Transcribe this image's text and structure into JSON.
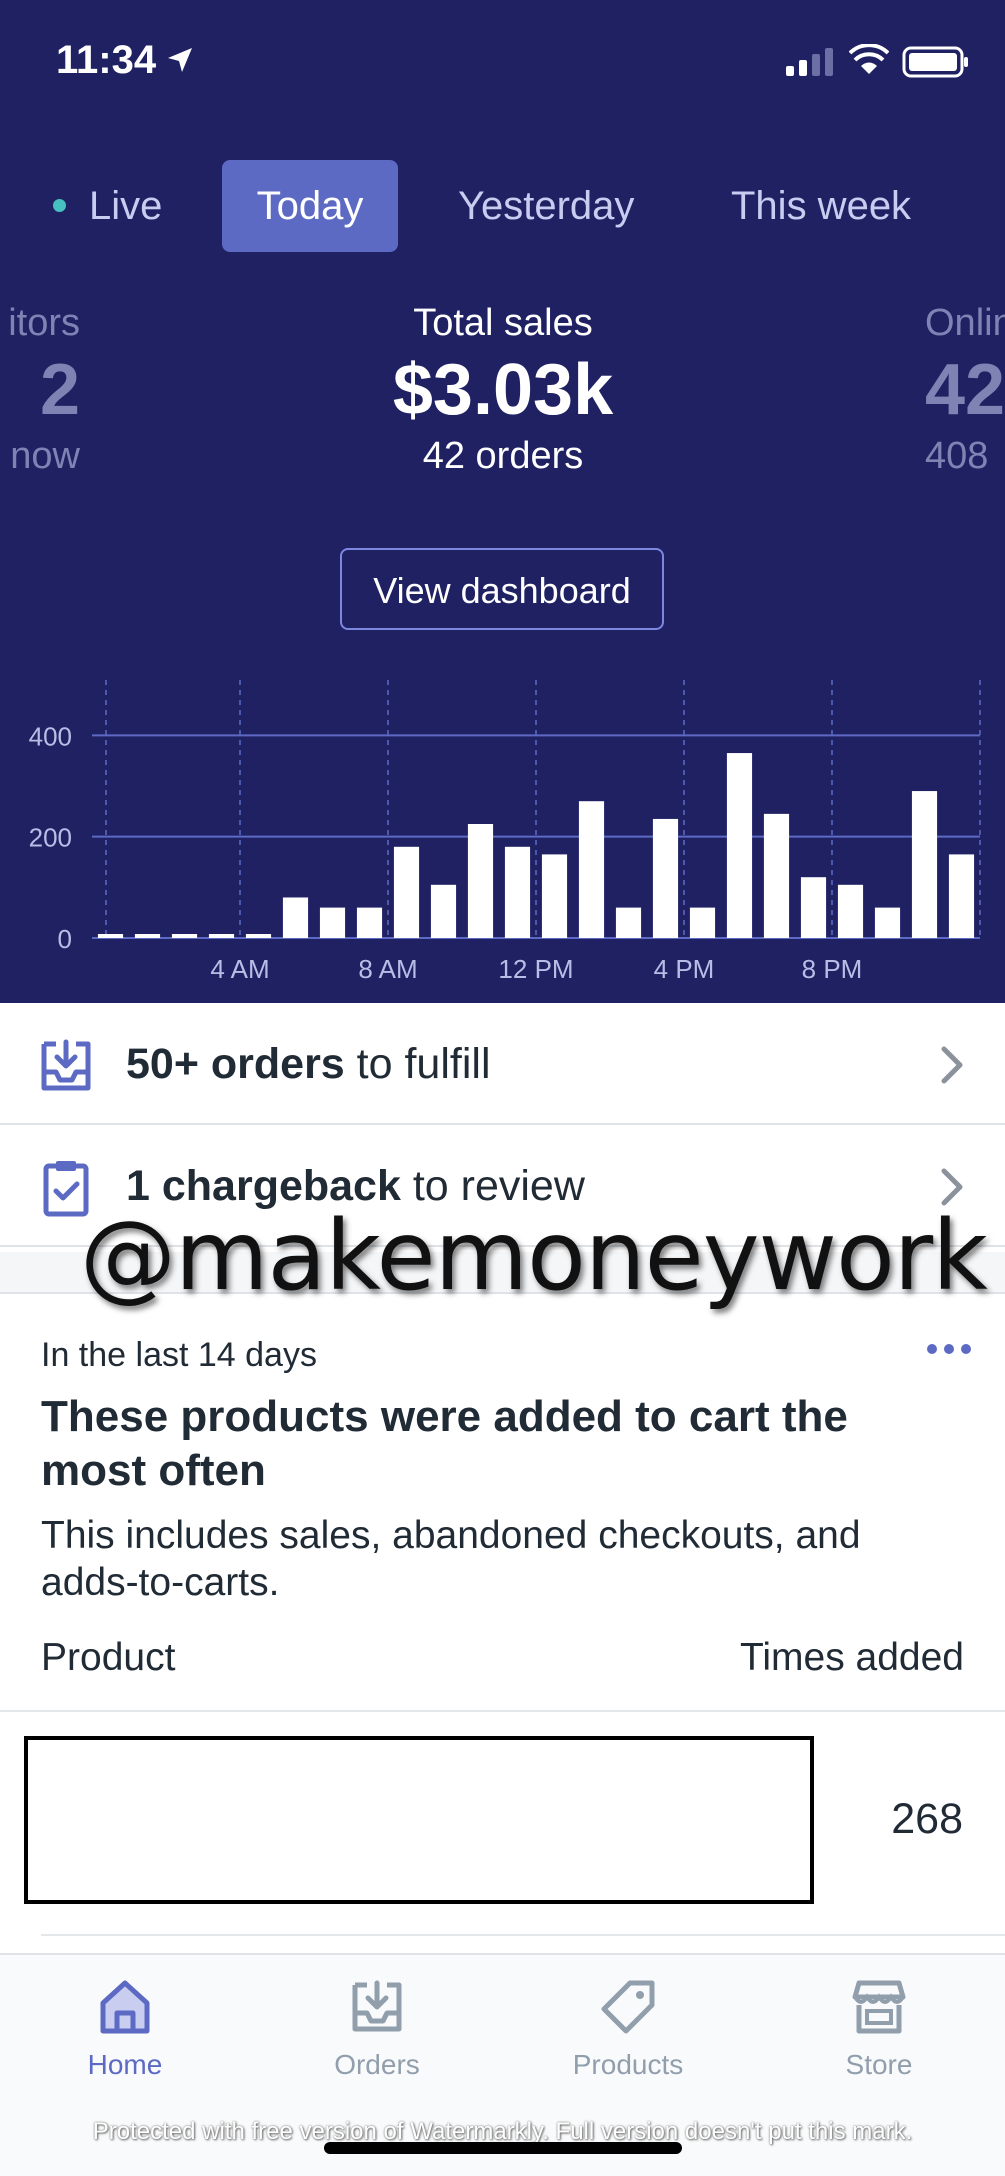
{
  "status_bar": {
    "time": "11:34"
  },
  "tabs": [
    {
      "label": "Live"
    },
    {
      "label": "Today"
    },
    {
      "label": "Yesterday"
    },
    {
      "label": "This week"
    }
  ],
  "active_tab": "Today",
  "metrics": {
    "left_partial": {
      "label": "itors",
      "value": "2",
      "sub": "now"
    },
    "main": {
      "label": "Total sales",
      "value": "$3.03k",
      "sub": "42 orders"
    },
    "right_partial": {
      "label": "Onlin",
      "value": "42",
      "sub": "408"
    }
  },
  "view_dashboard_label": "View dashboard",
  "chart_data": {
    "type": "bar",
    "categories": [
      "12 AM",
      "1 AM",
      "2 AM",
      "3 AM",
      "4 AM",
      "5 AM",
      "6 AM",
      "7 AM",
      "8 AM",
      "9 AM",
      "10 AM",
      "11 AM",
      "12 PM",
      "1 PM",
      "2 PM",
      "3 PM",
      "4 PM",
      "5 PM",
      "6 PM",
      "7 PM",
      "8 PM",
      "9 PM",
      "10 PM",
      "11 PM"
    ],
    "values": [
      5,
      5,
      5,
      5,
      5,
      80,
      60,
      60,
      180,
      105,
      225,
      180,
      165,
      270,
      60,
      235,
      60,
      365,
      245,
      120,
      105,
      60,
      290,
      165
    ],
    "ylim": [
      0,
      450
    ],
    "yticks": [
      "0",
      "200",
      "400"
    ],
    "xtick_labels": [
      "4 AM",
      "8 AM",
      "12 PM",
      "4 PM",
      "8 PM"
    ],
    "grid": true,
    "colors": {
      "bars": "#ffffff",
      "grid": "#5c6ac4",
      "background": "#1f2163"
    }
  },
  "tasks": {
    "orders": {
      "bold": "50+ orders",
      "rest": " to fulfill"
    },
    "chargeback": {
      "bold": "1 chargeback",
      "rest": " to review"
    }
  },
  "watermark_text": "@makemoneywork",
  "card": {
    "subtitle": "In the last 14 days",
    "title": "These products were added to cart the most often",
    "description": "This includes sales, abandoned checkouts, and adds-to-carts.",
    "col_product": "Product",
    "col_times": "Times added",
    "rows": [
      {
        "count": "268"
      }
    ]
  },
  "tabbar": [
    {
      "label": "Home",
      "icon": "home-icon",
      "active": true
    },
    {
      "label": "Orders",
      "icon": "orders-icon",
      "active": false
    },
    {
      "label": "Products",
      "icon": "products-icon",
      "active": false
    },
    {
      "label": "Store",
      "icon": "store-icon",
      "active": false
    }
  ],
  "protection_note": "Protected with free version of Watermarkly. Full version doesn't put this mark.",
  "colors": {
    "header_bg": "#1f2163",
    "accent": "#5c6ac4",
    "tab_inactive": "#919eab"
  }
}
